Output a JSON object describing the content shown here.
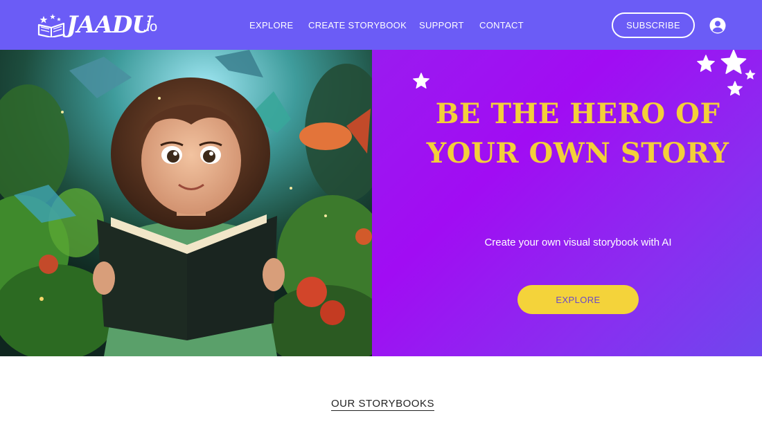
{
  "header": {
    "logo_text": "JAADU",
    "logo_suffix": ".io",
    "nav": [
      "EXPLORE",
      "CREATE STORYBOOK",
      "SUPPORT",
      "CONTACT"
    ],
    "subscribe_label": "SUBSCRIBE",
    "account_icon": "account-circle-icon"
  },
  "hero": {
    "image_subject": "girl-reading-book-in-enchanted-forest",
    "title": "BE THE HERO OF YOUR OWN STORY",
    "subtitle": "Create your own visual storybook with AI",
    "cta_label": "EXPLORE"
  },
  "section": {
    "title": "OUR STORYBOOKS"
  },
  "colors": {
    "header_bg": "#6b5cf6",
    "hero_gradient_start": "#9a1bf0",
    "hero_gradient_end": "#6f47ee",
    "title_yellow": "#f3cf3a",
    "cta_bg": "#f4d33a",
    "cta_text": "#6a48c9"
  }
}
